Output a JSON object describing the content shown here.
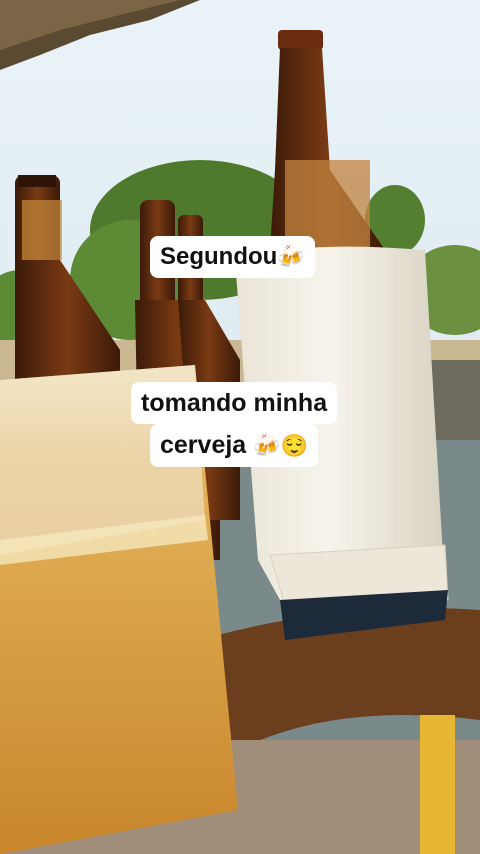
{
  "captions": {
    "first": {
      "text": "Segundou",
      "emoji": "🍻"
    },
    "second_line1": {
      "text": "tomando minha"
    },
    "second_line2": {
      "text": "cerveja",
      "emoji": "🍻😌"
    }
  },
  "scene": {
    "description_icons": [
      "beer-bottle-icon",
      "beer-glass-icon",
      "bottle-cooler-icon",
      "tree-icon",
      "thatched-roof-icon"
    ],
    "colors": {
      "sky": "#dfeef6",
      "beer": "#d9a441",
      "bottle": "#5b2a10",
      "cooler": "#f1ede3",
      "table": "#6b3e1e",
      "foliage": "#4f7a2e"
    }
  }
}
